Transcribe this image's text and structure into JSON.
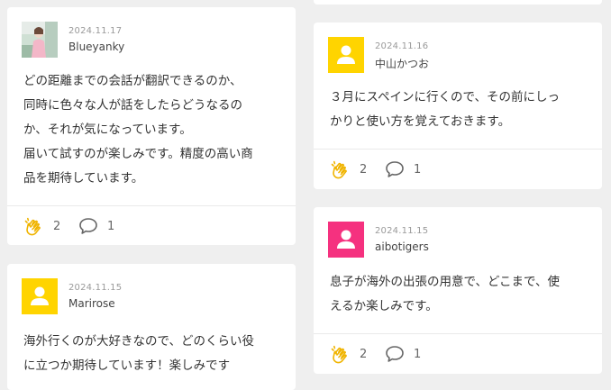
{
  "posts": [
    {
      "date": "2024.11.17",
      "author": "Blueyanky",
      "avatar": "photo-avatar",
      "lines": [
        "どの距離までの会話が翻訳できるのか、",
        "同時に色々な人が話をしたらどうなるの",
        "か、それが気になっています。",
        "届いて試すのが楽しみです。精度の高い商",
        "品を期待しています。"
      ],
      "claps": "2",
      "comments": "1"
    },
    {
      "date": "2024.11.15",
      "author": "Marirose",
      "avatar": "default-user-avatar",
      "avatar_color": "#ffd400",
      "lines": [
        "海外行くのが大好きなので、どのくらい役",
        "に立つか期待しています！楽しみです"
      ]
    },
    {
      "date": "2024.11.16",
      "author": "中山かつお",
      "avatar": "default-user-avatar",
      "avatar_color": "#ffd400",
      "lines": [
        "３月にスペインに行くので、その前にしっ",
        "かりと使い方を覚えておきます。"
      ],
      "claps": "2",
      "comments": "1"
    },
    {
      "date": "2024.11.15",
      "author": "aibotigers",
      "avatar": "default-user-avatar",
      "avatar_color": "#f5317f",
      "lines": [
        "息子が海外の出張の用意で、どこまで、使",
        "えるか楽しみです。"
      ],
      "claps": "2",
      "comments": "1"
    }
  ],
  "icons": {
    "clap": "clapping-hands-icon",
    "comment": "speech-bubble-icon"
  },
  "colors": {
    "clap_icon": "#f0b400",
    "comment_icon": "#666666"
  }
}
